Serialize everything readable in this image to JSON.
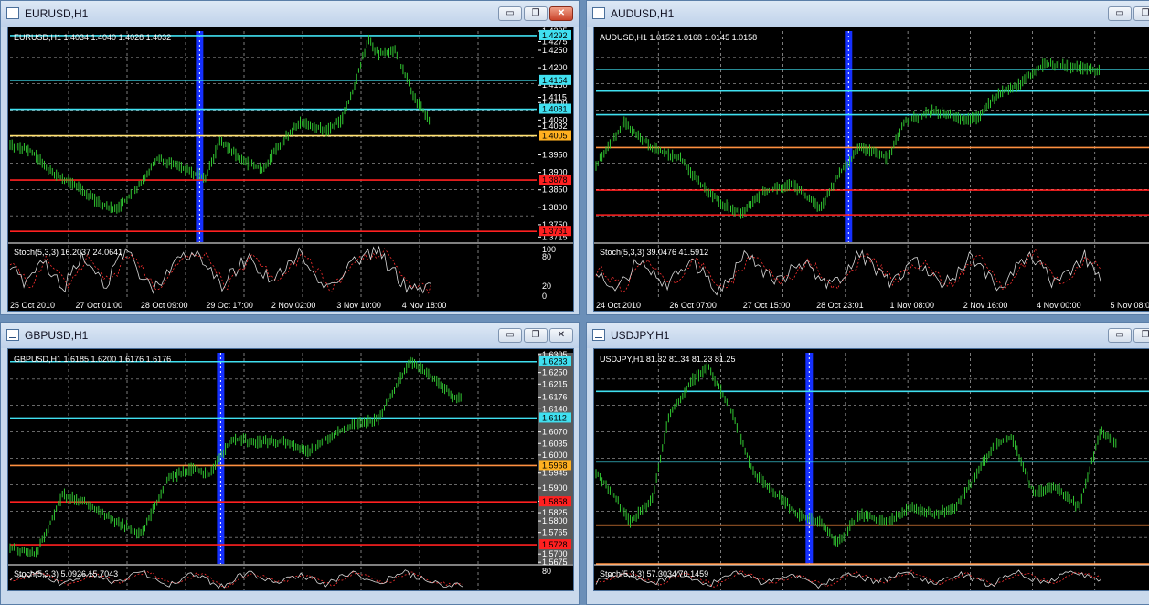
{
  "windows": [
    {
      "id": "eurusd",
      "title": "EURUSD,H1",
      "info": "EURUSD,H1  1.4034 1.4040 1.4028 1.4032",
      "stoch": "Stoch(5,3,3) 16.2037 24.0641",
      "buttons": {
        "minimize": "▭",
        "restore": "❐",
        "close": "✕"
      },
      "price_range": [
        1.37,
        1.4305
      ],
      "ticks": [
        "1.4305",
        "1.4275",
        "1.4250",
        "1.4200",
        "1.4150",
        "1.4115",
        "1.4100",
        "1.4050",
        "1.4032",
        "1.3950",
        "1.3900",
        "1.3850",
        "1.3800",
        "1.3750",
        "1.3715"
      ],
      "levels": [
        {
          "price": 1.4292,
          "label": "1.4292",
          "color": "#40e0f0",
          "bg": "#40e0f0",
          "fg": "#000000"
        },
        {
          "price": 1.4164,
          "label": "1.4164",
          "color": "#40e0f0",
          "bg": "#40e0f0",
          "fg": "#000000"
        },
        {
          "price": 1.4081,
          "label": "1.4081",
          "color": "#40e0f0",
          "bg": "#40e0f0",
          "fg": "#000000"
        },
        {
          "price": 1.4005,
          "label": "1.4005",
          "color": "#ffe070",
          "bg": "#ffb020",
          "fg": "#000000"
        },
        {
          "price": 1.3878,
          "label": "1.3878",
          "color": "#ff2020",
          "bg": "#ff2020",
          "fg": "#000000"
        },
        {
          "price": 1.3731,
          "label": "1.3731",
          "color": "#ff2020",
          "bg": "#ff2020",
          "fg": "#000000"
        }
      ],
      "price_path": [
        [
          0,
          1.3978
        ],
        [
          0.04,
          1.3963
        ],
        [
          0.08,
          1.3895
        ],
        [
          0.12,
          1.3868
        ],
        [
          0.16,
          1.3822
        ],
        [
          0.2,
          1.379
        ],
        [
          0.24,
          1.3852
        ],
        [
          0.28,
          1.394
        ],
        [
          0.32,
          1.3915
        ],
        [
          0.37,
          1.3885
        ],
        [
          0.4,
          1.3992
        ],
        [
          0.44,
          1.3932
        ],
        [
          0.48,
          1.391
        ],
        [
          0.52,
          1.3995
        ],
        [
          0.55,
          1.4045
        ],
        [
          0.6,
          1.402
        ],
        [
          0.63,
          1.405
        ],
        [
          0.65,
          1.413
        ],
        [
          0.68,
          1.428
        ],
        [
          0.7,
          1.424
        ],
        [
          0.73,
          1.425
        ],
        [
          0.77,
          1.411
        ],
        [
          0.8,
          1.404
        ]
      ],
      "vband": 0.36,
      "stoch_path": [
        [
          0,
          60
        ],
        [
          0.03,
          20
        ],
        [
          0.06,
          75
        ],
        [
          0.1,
          15
        ],
        [
          0.14,
          80
        ],
        [
          0.18,
          25
        ],
        [
          0.22,
          90
        ],
        [
          0.27,
          10
        ],
        [
          0.31,
          70
        ],
        [
          0.36,
          85
        ],
        [
          0.4,
          20
        ],
        [
          0.45,
          80
        ],
        [
          0.5,
          30
        ],
        [
          0.55,
          85
        ],
        [
          0.6,
          15
        ],
        [
          0.65,
          70
        ],
        [
          0.7,
          90
        ],
        [
          0.75,
          20
        ],
        [
          0.8,
          15
        ]
      ],
      "stoch_ticks": [
        "100",
        "80",
        "20",
        "0"
      ],
      "time_labels": [
        "25 Oct 2010",
        "27 Oct 01:00",
        "28 Oct 09:00",
        "29 Oct 17:00",
        "2 Nov 02:00",
        "3 Nov 10:00",
        "4 Nov 18:00"
      ]
    },
    {
      "id": "audusd",
      "title": "AUDUSD,H1",
      "info": "AUDUSD,H1  1.0152 1.0168 1.0145 1.0158",
      "stoch": "Stoch(5,3,3) 39.0476 41.5912",
      "buttons": {
        "minimize": "▭",
        "restore": "❐",
        "close": "✕"
      },
      "price_range": [
        0.97,
        1.028
      ],
      "ticks": [],
      "levels": [
        {
          "price": 1.0175,
          "label": "",
          "color": "#40e0f0",
          "bg": "",
          "fg": ""
        },
        {
          "price": 1.0115,
          "label": "",
          "color": "#40e0f0",
          "bg": "",
          "fg": ""
        },
        {
          "price": 1.005,
          "label": "",
          "color": "#40e0f0",
          "bg": "",
          "fg": ""
        },
        {
          "price": 0.996,
          "label": "",
          "color": "#ff9040",
          "bg": "",
          "fg": ""
        },
        {
          "price": 0.9843,
          "label": "",
          "color": "#ff2020",
          "bg": "",
          "fg": ""
        },
        {
          "price": 0.9775,
          "label": "",
          "color": "#ff2020",
          "bg": "",
          "fg": ""
        }
      ],
      "price_path": [
        [
          0,
          0.991
        ],
        [
          0.05,
          1.003
        ],
        [
          0.1,
          0.996
        ],
        [
          0.15,
          0.993
        ],
        [
          0.18,
          0.987
        ],
        [
          0.22,
          0.981
        ],
        [
          0.26,
          0.978
        ],
        [
          0.3,
          0.984
        ],
        [
          0.35,
          0.986
        ],
        [
          0.4,
          0.979
        ],
        [
          0.43,
          0.988
        ],
        [
          0.47,
          0.996
        ],
        [
          0.52,
          0.993
        ],
        [
          0.55,
          1.003
        ],
        [
          0.6,
          1.006
        ],
        [
          0.65,
          1.004
        ],
        [
          0.68,
          1.004
        ],
        [
          0.7,
          1.008
        ],
        [
          0.72,
          1.011
        ],
        [
          0.75,
          1.013
        ],
        [
          0.8,
          1.019
        ],
        [
          0.86,
          1.018
        ],
        [
          0.9,
          1.017
        ]
      ],
      "vband": 0.45,
      "stoch_path": [
        [
          0,
          50
        ],
        [
          0.04,
          15
        ],
        [
          0.08,
          80
        ],
        [
          0.12,
          20
        ],
        [
          0.17,
          75
        ],
        [
          0.22,
          10
        ],
        [
          0.27,
          90
        ],
        [
          0.32,
          25
        ],
        [
          0.37,
          70
        ],
        [
          0.42,
          15
        ],
        [
          0.47,
          85
        ],
        [
          0.52,
          30
        ],
        [
          0.57,
          70
        ],
        [
          0.62,
          20
        ],
        [
          0.67,
          80
        ],
        [
          0.72,
          15
        ],
        [
          0.77,
          90
        ],
        [
          0.82,
          20
        ],
        [
          0.87,
          80
        ],
        [
          0.9,
          30
        ]
      ],
      "stoch_ticks": [],
      "time_labels": [
        "24 Oct 2010",
        "26 Oct 07:00",
        "27 Oct 15:00",
        "28 Oct 23:01",
        "1 Nov 08:00",
        "2 Nov 16:00",
        "4 Nov 00:00",
        "5 Nov 08:00"
      ]
    },
    {
      "id": "gbpusd",
      "title": "GBPUSD,H1",
      "info": "GBPUSD,H1  1.6185 1.6200 1.6176 1.6176",
      "stoch": "Stoch(5,3,3) 5.0926 15.7043",
      "buttons": {
        "minimize": "▭",
        "restore": "❐",
        "close": "✕"
      },
      "price_range": [
        1.567,
        1.631
      ],
      "ticks": [
        "1.6305",
        "1.6250",
        "1.6215",
        "1.6176",
        "1.6140",
        "1.6070",
        "1.6035",
        "1.6000",
        "1.5945",
        "1.5900",
        "1.5860",
        "1.5825",
        "1.5800",
        "1.5765",
        "1.5700",
        "1.5675"
      ],
      "levels": [
        {
          "price": 1.6283,
          "label": "1.6283",
          "color": "#40e0f0",
          "bg": "#40e0f0",
          "fg": "#000000"
        },
        {
          "price": 1.6112,
          "label": "1.6112",
          "color": "#40e0f0",
          "bg": "#40e0f0",
          "fg": "#000000"
        },
        {
          "price": 1.5968,
          "label": "1.5968",
          "color": "#ff9040",
          "bg": "#ffb020",
          "fg": "#000000"
        },
        {
          "price": 1.5858,
          "label": "1.5858",
          "color": "#ff2020",
          "bg": "#ff2020",
          "fg": "#000000"
        },
        {
          "price": 1.5728,
          "label": "1.5728",
          "color": "#ff2020",
          "bg": "#ff2020",
          "fg": "#000000"
        }
      ],
      "price_path": [
        [
          0,
          1.572
        ],
        [
          0.05,
          1.57
        ],
        [
          0.1,
          1.588
        ],
        [
          0.15,
          1.585
        ],
        [
          0.2,
          1.58
        ],
        [
          0.25,
          1.576
        ],
        [
          0.3,
          1.593
        ],
        [
          0.35,
          1.596
        ],
        [
          0.38,
          1.594
        ],
        [
          0.42,
          1.605
        ],
        [
          0.47,
          1.604
        ],
        [
          0.52,
          1.604
        ],
        [
          0.57,
          1.601
        ],
        [
          0.6,
          1.605
        ],
        [
          0.65,
          1.609
        ],
        [
          0.7,
          1.611
        ],
        [
          0.73,
          1.62
        ],
        [
          0.76,
          1.6285
        ],
        [
          0.8,
          1.624
        ],
        [
          0.84,
          1.618
        ],
        [
          0.86,
          1.617
        ]
      ],
      "vband": 0.4,
      "stoch_path": [
        [
          0,
          40
        ],
        [
          0.05,
          80
        ],
        [
          0.1,
          20
        ],
        [
          0.15,
          70
        ],
        [
          0.2,
          30
        ],
        [
          0.25,
          85
        ],
        [
          0.3,
          20
        ],
        [
          0.35,
          75
        ],
        [
          0.4,
          10
        ],
        [
          0.45,
          80
        ],
        [
          0.5,
          30
        ],
        [
          0.55,
          70
        ],
        [
          0.6,
          20
        ],
        [
          0.65,
          85
        ],
        [
          0.7,
          25
        ],
        [
          0.75,
          80
        ],
        [
          0.8,
          30
        ],
        [
          0.86,
          10
        ]
      ],
      "stoch_ticks": [
        "80"
      ],
      "time_labels": []
    },
    {
      "id": "usdjpy",
      "title": "USDJPY,H1",
      "info": "USDJPY,H1  81.32 81.34 81.23 81.25",
      "stoch": "Stoch(5,3,3) 57.3034 70.1459",
      "buttons": {
        "minimize": "▭",
        "restore": "❐",
        "close": "✕"
      },
      "price_range": [
        80.2,
        83.2
      ],
      "ticks": [],
      "levels": [
        {
          "price": 82.65,
          "label": "",
          "color": "#40e0f0",
          "bg": "",
          "fg": ""
        },
        {
          "price": 81.65,
          "label": "",
          "color": "#40e0f0",
          "bg": "",
          "fg": ""
        },
        {
          "price": 80.75,
          "label": "",
          "color": "#ff9040",
          "bg": "",
          "fg": ""
        },
        {
          "price": 80.2,
          "label": "",
          "color": "#ff9040",
          "bg": "",
          "fg": ""
        }
      ],
      "price_path": [
        [
          0,
          81.5
        ],
        [
          0.03,
          81.2
        ],
        [
          0.06,
          80.8
        ],
        [
          0.1,
          81.1
        ],
        [
          0.13,
          82.3
        ],
        [
          0.17,
          82.8
        ],
        [
          0.2,
          83.0
        ],
        [
          0.24,
          82.4
        ],
        [
          0.28,
          81.5
        ],
        [
          0.32,
          81.2
        ],
        [
          0.36,
          80.9
        ],
        [
          0.4,
          80.8
        ],
        [
          0.43,
          80.5
        ],
        [
          0.47,
          80.9
        ],
        [
          0.52,
          80.8
        ],
        [
          0.56,
          81.0
        ],
        [
          0.6,
          80.9
        ],
        [
          0.64,
          81.0
        ],
        [
          0.68,
          81.5
        ],
        [
          0.71,
          81.9
        ],
        [
          0.74,
          82.0
        ],
        [
          0.78,
          81.2
        ],
        [
          0.82,
          81.3
        ],
        [
          0.86,
          81.0
        ],
        [
          0.9,
          82.1
        ],
        [
          0.93,
          81.9
        ]
      ],
      "vband": 0.38,
      "stoch_path": [
        [
          0,
          30
        ],
        [
          0.05,
          80
        ],
        [
          0.1,
          20
        ],
        [
          0.15,
          75
        ],
        [
          0.2,
          15
        ],
        [
          0.25,
          85
        ],
        [
          0.3,
          25
        ],
        [
          0.35,
          70
        ],
        [
          0.4,
          10
        ],
        [
          0.45,
          80
        ],
        [
          0.5,
          30
        ],
        [
          0.55,
          85
        ],
        [
          0.6,
          20
        ],
        [
          0.65,
          75
        ],
        [
          0.7,
          15
        ],
        [
          0.75,
          80
        ],
        [
          0.8,
          25
        ],
        [
          0.85,
          85
        ],
        [
          0.9,
          40
        ]
      ],
      "stoch_ticks": [],
      "time_labels": []
    }
  ]
}
